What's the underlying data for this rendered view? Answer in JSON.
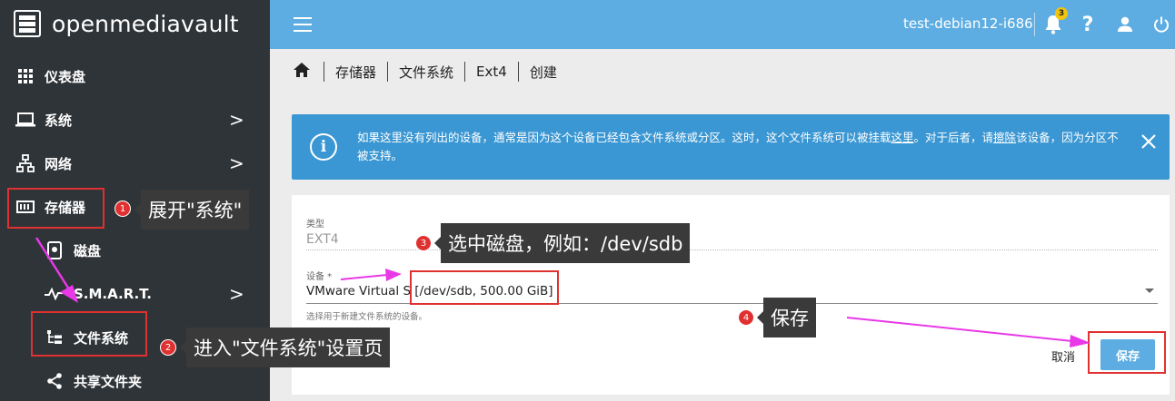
{
  "brand": {
    "name": "openmediavault"
  },
  "sidebar": {
    "items": [
      {
        "label": "仪表盘",
        "icon": "dashboard-grid-icon"
      },
      {
        "label": "系统",
        "icon": "laptop-icon",
        "chevron": ">"
      },
      {
        "label": "网络",
        "icon": "network-icon",
        "chevron": ">"
      },
      {
        "label": "存储器",
        "icon": "storage-icon"
      },
      {
        "label": "磁盘",
        "icon": "disk-icon"
      },
      {
        "label": "S.M.A.R.T.",
        "icon": "pulse-icon",
        "chevron": ">"
      },
      {
        "label": "文件系统",
        "icon": "filesystem-tree-icon"
      },
      {
        "label": "共享文件夹",
        "icon": "share-icon"
      }
    ]
  },
  "topbar": {
    "hostname": "test-debian12-i686",
    "notification_count": "3",
    "help": "?"
  },
  "breadcrumb": [
    "存储器",
    "文件系统",
    "Ext4",
    "创建"
  ],
  "alert": {
    "text_before_link": "如果这里没有列出的设备，通常是因为这个设备已经包含文件系统或分区。这时，这个文件系统可以被挂载",
    "link1": "这里",
    "text_mid": "。对于后者，请",
    "link2": "擦除",
    "text_after": "该设备，因为分区不被支持。"
  },
  "form": {
    "type_label": "类型",
    "type_value": "EXT4",
    "device_label": "设备 *",
    "device_value": "VMware Virtual S [/dev/sdb, 500.00 GiB]",
    "device_hint": "选择用于新建文件系统的设备。",
    "cancel_label": "取消",
    "save_label": "保存"
  },
  "annotations": {
    "step1": {
      "num": "1",
      "text": "展开\"系统\""
    },
    "step2": {
      "num": "2",
      "text": "进入\"文件系统\"设置页"
    },
    "step3": {
      "num": "3",
      "text": "选中磁盘，例如：/dev/sdb"
    },
    "step4": {
      "num": "4",
      "text": "保存"
    },
    "highlight_color": "#e03131",
    "arrow_color": "#e838e8"
  },
  "colors": {
    "sidebar": "#2f3438",
    "topbar": "#5dade2",
    "alert": "#3b97d3",
    "primary_button": "#5dade2"
  }
}
